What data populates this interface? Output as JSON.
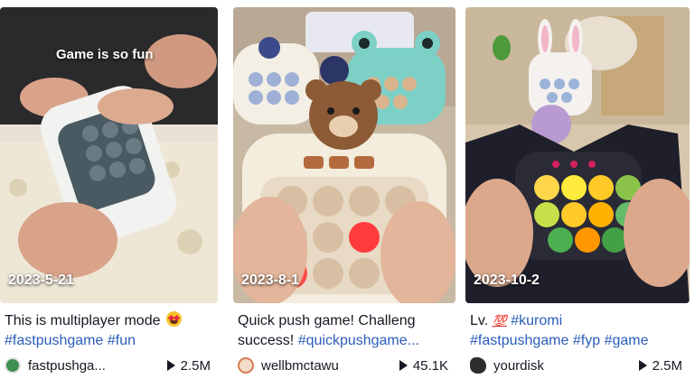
{
  "videos": [
    {
      "overlay_text": "Game is so fun",
      "date": "2023-5-21",
      "desc_text": "This is multiplayer mode",
      "desc_emoji": "star-struck-emoji",
      "tags_line": [
        "#fastpushgame",
        "#fun"
      ],
      "author": "fastpushga...",
      "plays": "2.5M"
    },
    {
      "overlay_text": "",
      "date": "2023-8-1",
      "desc_text": "Quick push game! Challeng",
      "desc_line2_text": "success! ",
      "desc_line2_tag": "#quickpushgame...",
      "author": "wellbmctawu",
      "plays": "45.1K"
    },
    {
      "overlay_text": "",
      "date": "2023-10-2",
      "desc_text": "Lv.",
      "desc_emoji": "hundred-points-emoji",
      "desc_tag": "#kuromi",
      "tags_line": [
        "#fastpushgame",
        "#fyp",
        "#game"
      ],
      "author": "yourdisk",
      "plays": "2.5M"
    }
  ],
  "colors": {
    "tag": "#2b5db9",
    "text": "#161823"
  }
}
